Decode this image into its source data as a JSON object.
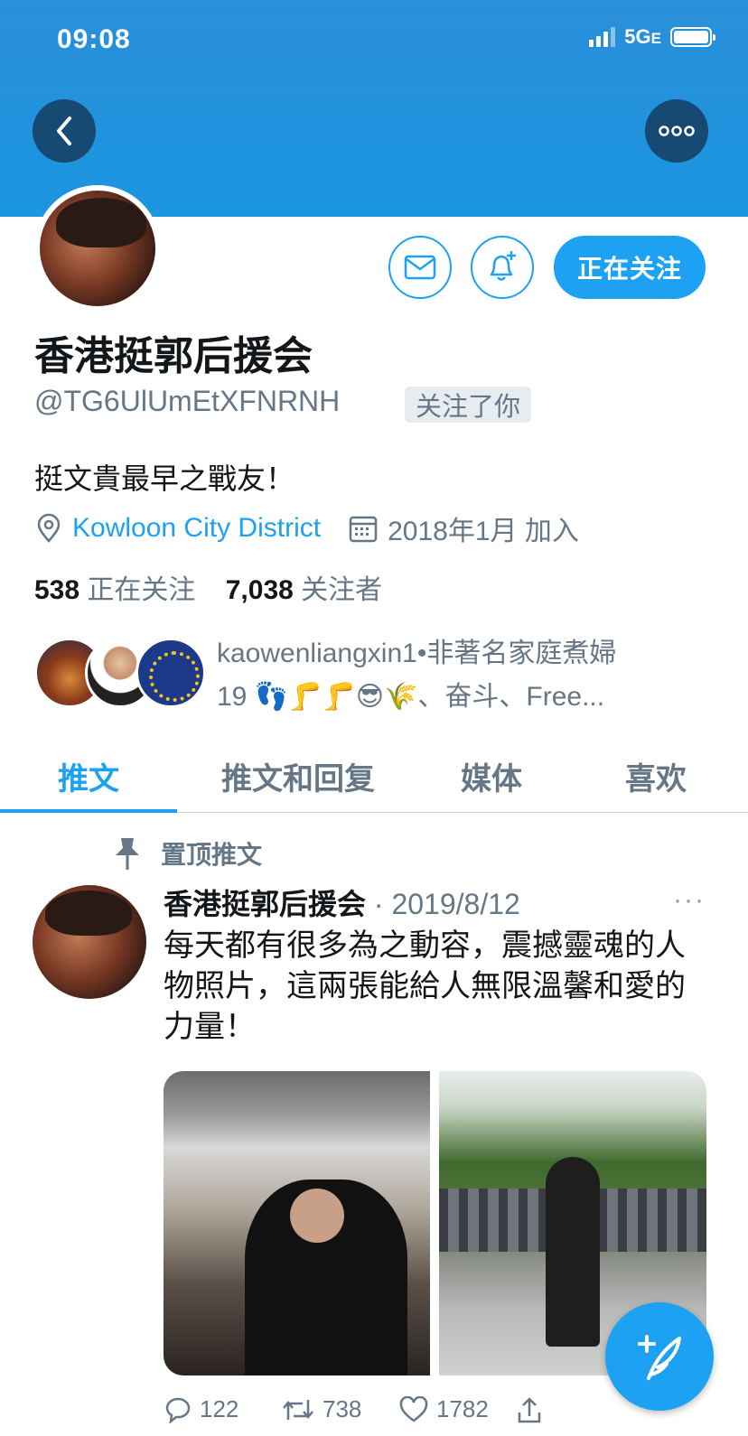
{
  "status": {
    "time": "09:08",
    "network": "5G",
    "network_suffix": "E"
  },
  "profile": {
    "name": "香港挺郭后援会",
    "handle": "@TG6UlUmEtXFNRNH",
    "follows_you": "关注了你",
    "bio": "挺文貴最早之戰友！",
    "location": "Kowloon City District",
    "joined": "2018年1月 加入",
    "following_count": "538",
    "following_label": "正在关注",
    "followers_count": "7,038",
    "followers_label": "关注者",
    "follow_button": "正在关注"
  },
  "followed_by": {
    "line1": "kaowenliangxin1•非著名家庭煮婦",
    "line2": "19 👣🦵🦵😎🌾、奋斗、Free..."
  },
  "tabs": [
    "推文",
    "推文和回复",
    "媒体",
    "喜欢"
  ],
  "pinned": {
    "label": "置顶推文",
    "author": "香港挺郭后援会",
    "date": "· 2019/8/12",
    "more": "···",
    "text": "每天都有很多為之動容，震撼靈魂的人物照片，這兩張能給人無限溫馨和愛的力量！",
    "replies": "122",
    "retweets": "738",
    "likes": "1782"
  },
  "colors": {
    "accent": "#1da1f2",
    "banner": "#1a95e0",
    "dark_button": "#164a72"
  },
  "icons": [
    "back-arrow-icon",
    "more-icon",
    "mail-icon",
    "bell-plus-icon",
    "location-icon",
    "calendar-icon",
    "pin-icon",
    "reply-icon",
    "retweet-icon",
    "like-icon",
    "share-icon",
    "compose-icon"
  ]
}
